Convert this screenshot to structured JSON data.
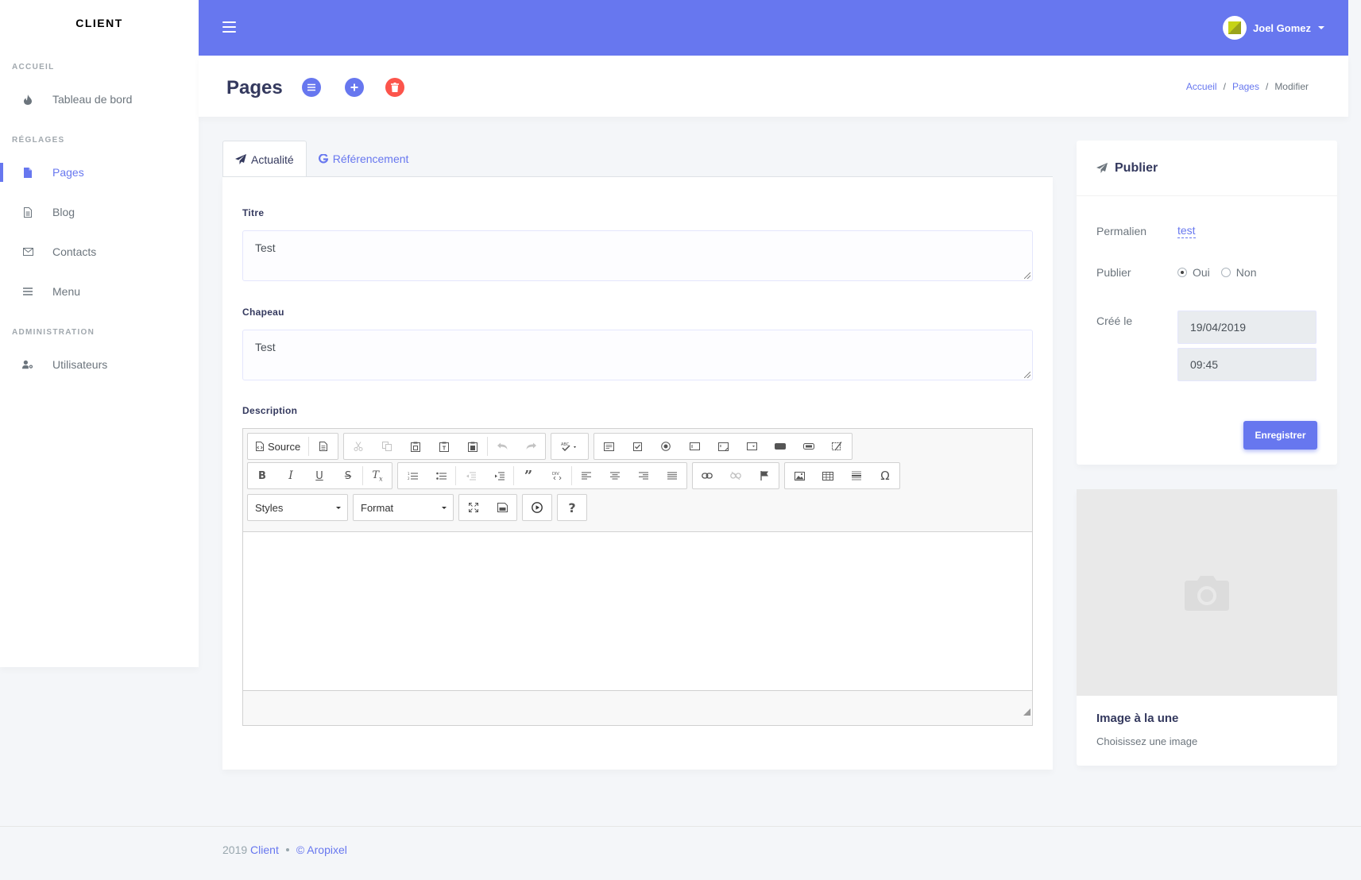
{
  "brand": "CLIENT",
  "sidebar": {
    "sections": [
      {
        "header": "ACCUEIL",
        "items": [
          {
            "label": "Tableau de bord",
            "icon": "fire-icon"
          }
        ]
      },
      {
        "header": "RÉGLAGES",
        "items": [
          {
            "label": "Pages",
            "icon": "file-icon",
            "active": true
          },
          {
            "label": "Blog",
            "icon": "file-text-icon"
          },
          {
            "label": "Contacts",
            "icon": "envelope-icon"
          },
          {
            "label": "Menu",
            "icon": "bars-icon"
          }
        ]
      },
      {
        "header": "ADMINISTRATION",
        "items": [
          {
            "label": "Utilisateurs",
            "icon": "users-cog-icon"
          }
        ]
      }
    ]
  },
  "navbar": {
    "user_name": "Joel Gomez"
  },
  "header": {
    "title": "Pages",
    "breadcrumb": [
      "Accueil",
      "Pages",
      "Modifier"
    ]
  },
  "tabs": [
    {
      "label": "Actualité",
      "icon": "paper-plane-icon",
      "active": true
    },
    {
      "label": "Référencement",
      "icon": "google-icon",
      "active": false
    }
  ],
  "form": {
    "title_label": "Titre",
    "title_value": "Test",
    "chapeau_label": "Chapeau",
    "chapeau_value": "Test",
    "description_label": "Description"
  },
  "editor": {
    "source_label": "Source",
    "styles_label": "Styles",
    "format_label": "Format"
  },
  "publish": {
    "title": "Publier",
    "permalink_label": "Permalien",
    "permalink_value": "test",
    "publish_label": "Publier",
    "options": [
      "Oui",
      "Non"
    ],
    "selected_option": "Oui",
    "created_label": "Créé le",
    "date_value": "19/04/2019",
    "time_value": "09:45",
    "save_label": "Enregistrer"
  },
  "featured_image": {
    "title": "Image à la une",
    "subtitle": "Choisissez une image"
  },
  "footer": {
    "year": "2019",
    "client_link": "Client",
    "copyright": "© Aropixel"
  },
  "colors": {
    "primary": "#6777ef",
    "danger": "#fc544b",
    "background": "#f4f6f9"
  }
}
